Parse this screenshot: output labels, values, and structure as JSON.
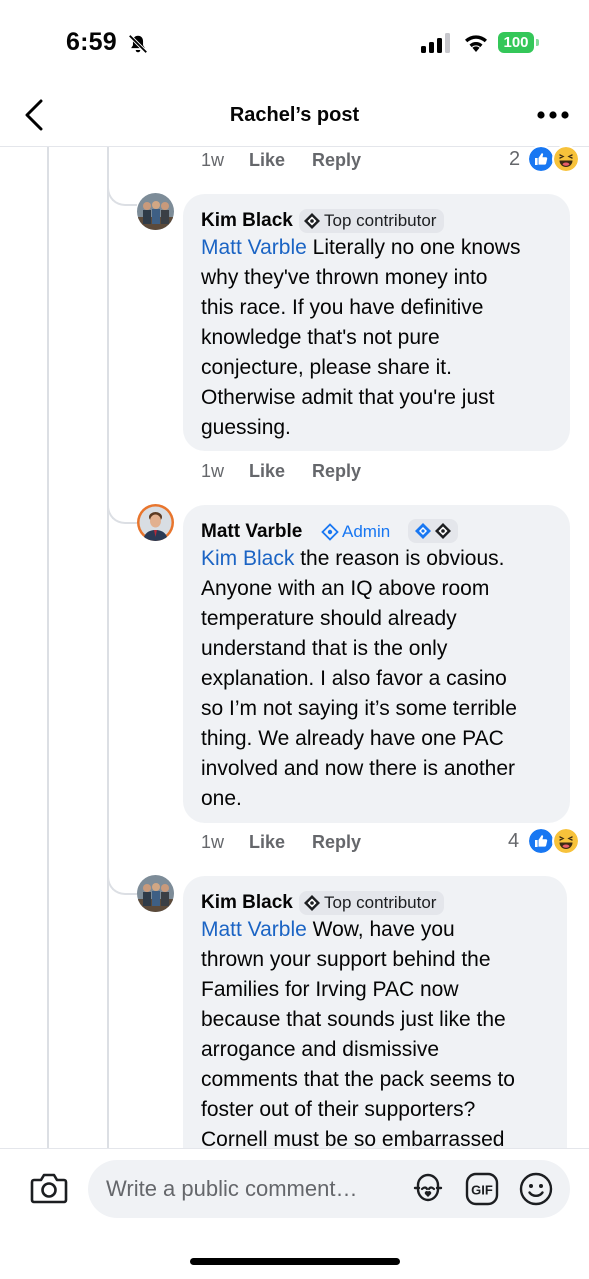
{
  "status_bar": {
    "time": "6:59",
    "battery": "100"
  },
  "header": {
    "title": "Rachel’s post"
  },
  "top_meta": {
    "time": "1w",
    "like": "Like",
    "reply": "Reply",
    "reaction_count": "2"
  },
  "comments": [
    {
      "author": "Kim Black",
      "badge": "Top contributor",
      "mention": "Matt Varble",
      "lines": [
        " Literally no one knows",
        "why they've thrown money into",
        "this race. If you have definitive",
        "knowledge that's not pure",
        "conjecture, please share it.",
        "Otherwise admit that you're just",
        "guessing."
      ],
      "time": "1w",
      "like": "Like",
      "reply": "Reply"
    },
    {
      "author": "Matt Varble",
      "badge": "Admin",
      "mention": "Kim Black",
      "lines": [
        " the reason is obvious.",
        "Anyone with an IQ above room",
        "temperature should already",
        "understand that is the only",
        "explanation. I also favor a casino",
        "so I’m not saying it’s some terrible",
        "thing. We already have one PAC",
        "involved and now there is another",
        "one."
      ],
      "time": "1w",
      "like": "Like",
      "reply": "Reply",
      "reaction_count": "4"
    },
    {
      "author": "Kim Black",
      "badge": "Top contributor",
      "mention": "Matt Varble",
      "lines": [
        " Wow, have you",
        "thrown your support behind the",
        "Families for Irving PAC now",
        "because that sounds just like the",
        "arrogance and dismissive",
        "comments that the pack seems to",
        "foster out of their supporters?",
        "Cornell must be so embarrassed"
      ]
    }
  ],
  "composer": {
    "placeholder": "Write a public comment…"
  },
  "colors": {
    "accent": "#1877f2",
    "mention": "#1b64c4",
    "bubble": "#f0f2f5",
    "battery": "#34c759"
  },
  "icons": [
    "bell-slash-icon",
    "signal-icon",
    "wifi-icon",
    "battery-icon",
    "back-chevron-icon",
    "more-icon",
    "top-contributor-icon",
    "admin-icon",
    "like-reaction-icon",
    "haha-reaction-icon",
    "camera-icon",
    "avatar-sticker-icon",
    "gif-icon",
    "emoji-icon"
  ]
}
